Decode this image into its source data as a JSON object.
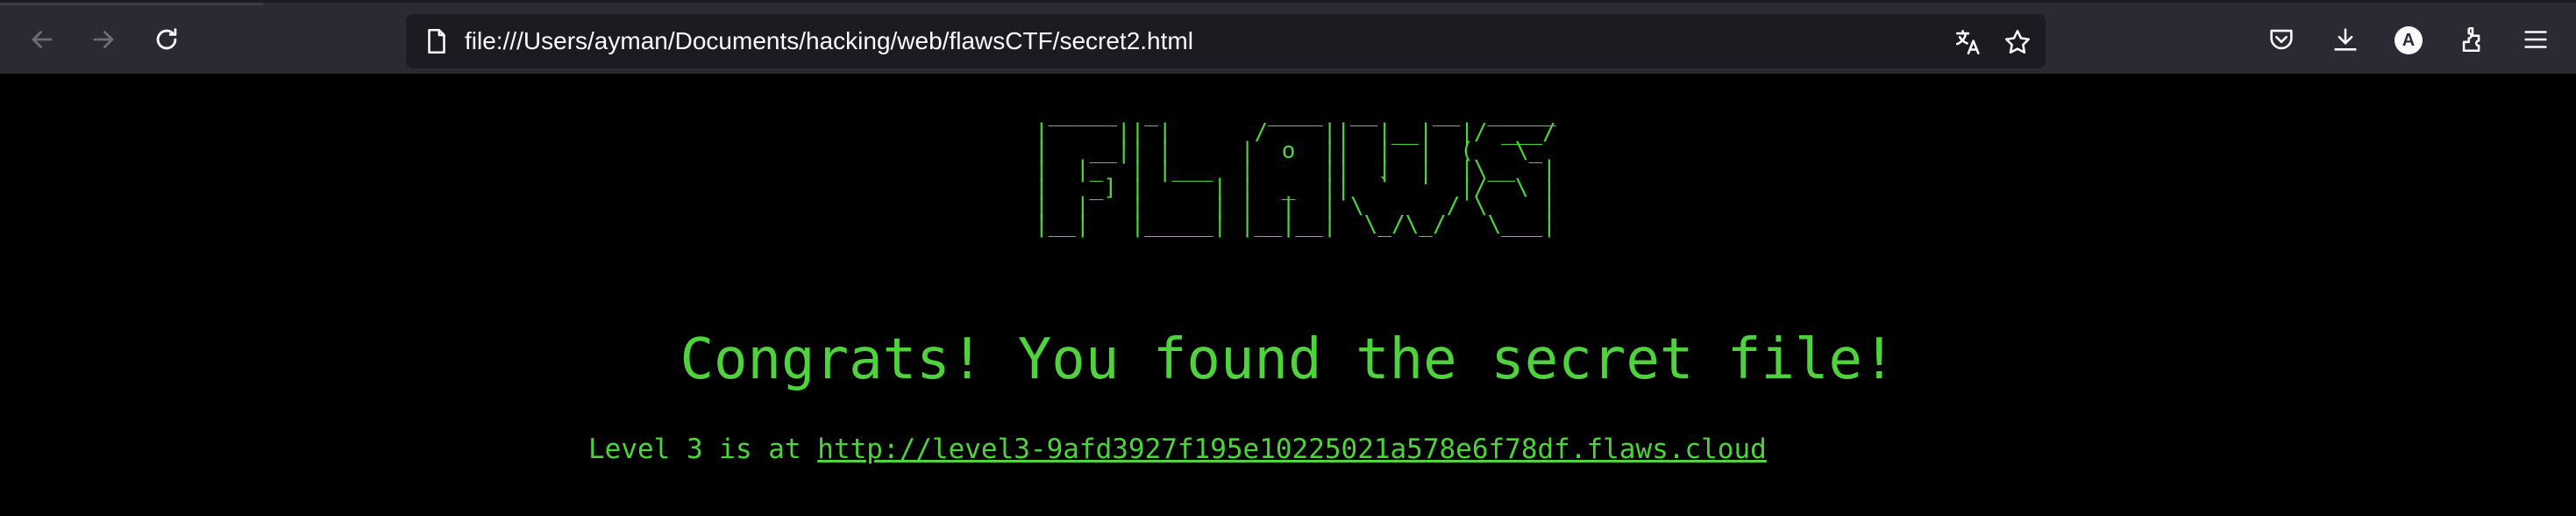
{
  "browser": {
    "url": "file:///Users/ayman/Documents/hacking/web/flawsCTF/secret2.html",
    "account_initial": "A",
    "icons": {
      "back": "arrow-left-icon",
      "forward": "arrow-right-icon",
      "reload": "reload-icon",
      "page": "page-icon",
      "translate": "translate-icon",
      "bookmark": "star-icon",
      "pocket": "pocket-icon",
      "downloads": "download-icon",
      "account": "account-avatar",
      "extensions": "puzzle-icon",
      "menu": "hamburger-menu-icon"
    }
  },
  "page": {
    "ascii_logo": " _____  _        ____  __    __  _____\n|     || |      /    ||  |__|  |/ ___/\n|   __|| |     |  o  ||  |  |  (   \\_\n|  |_  | |___  |     ||  |  |  |\\__  |\n|   _] |     | |  _  ||  `  '  |/  \\ |\n|  |   |     | |  |  | \\      / \\    |\n|__|   |_____| |__|__|  \\_/\\_/   \\___|",
    "headline": "Congrats! You found the secret file!",
    "level_prefix": "Level 3 is at ",
    "level_link": "http://level3-9afd3927f195e10225021a578e6f78df.flaws.cloud"
  },
  "colors": {
    "terminal_green": "#4ed33c",
    "page_background": "#000000",
    "toolbar_background": "#2b2a33",
    "urlbar_background": "#1c1b22",
    "icon_color": "#fbfbfe"
  }
}
